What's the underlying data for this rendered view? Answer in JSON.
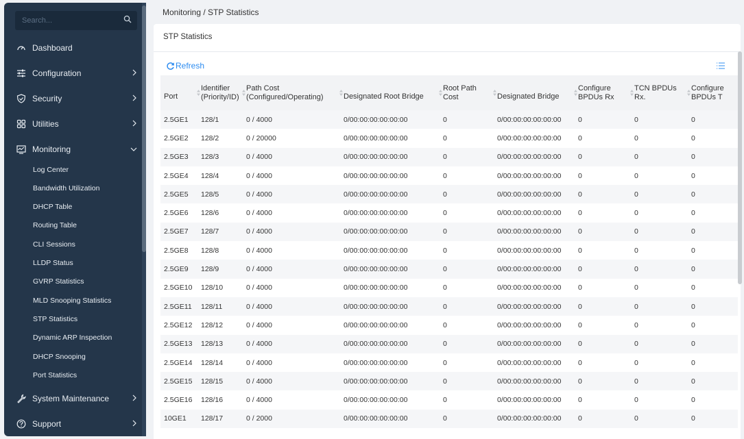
{
  "sidebar": {
    "search_placeholder": "Search...",
    "nav": [
      {
        "label": "Dashboard"
      },
      {
        "label": "Configuration"
      },
      {
        "label": "Security"
      },
      {
        "label": "Utilities"
      },
      {
        "label": "Monitoring"
      },
      {
        "label": "System Maintenance"
      },
      {
        "label": "Support"
      }
    ],
    "monitoring_items": [
      "Log Center",
      "Bandwidth Utilization",
      "DHCP Table",
      "Routing Table",
      "CLI Sessions",
      "LLDP Status",
      "GVRP Statistics",
      "MLD Snooping Statistics",
      "STP Statistics",
      "Dynamic ARP Inspection",
      "DHCP Snooping",
      "Port Statistics"
    ]
  },
  "breadcrumb": "Monitoring /  STP Statistics",
  "panel_title": "STP Statistics",
  "refresh_label": "Refresh",
  "table": {
    "headers": [
      "Port",
      "Identifier (Priority/ID)",
      "Path Cost (Configured/Operating)",
      "Designated Root Bridge",
      "Root Path Cost",
      "Designated Bridge",
      "Configure BPDUs Rx",
      "TCN BPDUs Rx.",
      "Configure BPDUs T"
    ],
    "rows": [
      [
        "2.5GE1",
        "128/1",
        "0 / 4000",
        "0/00:00:00:00:00:00",
        "0",
        "0/00:00:00:00:00:00",
        "0",
        "0",
        "0"
      ],
      [
        "2.5GE2",
        "128/2",
        "0 / 20000",
        "0/00:00:00:00:00:00",
        "0",
        "0/00:00:00:00:00:00",
        "0",
        "0",
        "0"
      ],
      [
        "2.5GE3",
        "128/3",
        "0 / 4000",
        "0/00:00:00:00:00:00",
        "0",
        "0/00:00:00:00:00:00",
        "0",
        "0",
        "0"
      ],
      [
        "2.5GE4",
        "128/4",
        "0 / 4000",
        "0/00:00:00:00:00:00",
        "0",
        "0/00:00:00:00:00:00",
        "0",
        "0",
        "0"
      ],
      [
        "2.5GE5",
        "128/5",
        "0 / 4000",
        "0/00:00:00:00:00:00",
        "0",
        "0/00:00:00:00:00:00",
        "0",
        "0",
        "0"
      ],
      [
        "2.5GE6",
        "128/6",
        "0 / 4000",
        "0/00:00:00:00:00:00",
        "0",
        "0/00:00:00:00:00:00",
        "0",
        "0",
        "0"
      ],
      [
        "2.5GE7",
        "128/7",
        "0 / 4000",
        "0/00:00:00:00:00:00",
        "0",
        "0/00:00:00:00:00:00",
        "0",
        "0",
        "0"
      ],
      [
        "2.5GE8",
        "128/8",
        "0 / 4000",
        "0/00:00:00:00:00:00",
        "0",
        "0/00:00:00:00:00:00",
        "0",
        "0",
        "0"
      ],
      [
        "2.5GE9",
        "128/9",
        "0 / 4000",
        "0/00:00:00:00:00:00",
        "0",
        "0/00:00:00:00:00:00",
        "0",
        "0",
        "0"
      ],
      [
        "2.5GE10",
        "128/10",
        "0 / 4000",
        "0/00:00:00:00:00:00",
        "0",
        "0/00:00:00:00:00:00",
        "0",
        "0",
        "0"
      ],
      [
        "2.5GE11",
        "128/11",
        "0 / 4000",
        "0/00:00:00:00:00:00",
        "0",
        "0/00:00:00:00:00:00",
        "0",
        "0",
        "0"
      ],
      [
        "2.5GE12",
        "128/12",
        "0 / 4000",
        "0/00:00:00:00:00:00",
        "0",
        "0/00:00:00:00:00:00",
        "0",
        "0",
        "0"
      ],
      [
        "2.5GE13",
        "128/13",
        "0 / 4000",
        "0/00:00:00:00:00:00",
        "0",
        "0/00:00:00:00:00:00",
        "0",
        "0",
        "0"
      ],
      [
        "2.5GE14",
        "128/14",
        "0 / 4000",
        "0/00:00:00:00:00:00",
        "0",
        "0/00:00:00:00:00:00",
        "0",
        "0",
        "0"
      ],
      [
        "2.5GE15",
        "128/15",
        "0 / 4000",
        "0/00:00:00:00:00:00",
        "0",
        "0/00:00:00:00:00:00",
        "0",
        "0",
        "0"
      ],
      [
        "2.5GE16",
        "128/16",
        "0 / 4000",
        "0/00:00:00:00:00:00",
        "0",
        "0/00:00:00:00:00:00",
        "0",
        "0",
        "0"
      ],
      [
        "10GE1",
        "128/17",
        "0 / 2000",
        "0/00:00:00:00:00:00",
        "0",
        "0/00:00:00:00:00:00",
        "0",
        "0",
        "0"
      ]
    ]
  },
  "colors": {
    "sidebar_bg": "#24364a",
    "accent": "#2d8cf0",
    "header_bg": "#f2f3f5"
  }
}
